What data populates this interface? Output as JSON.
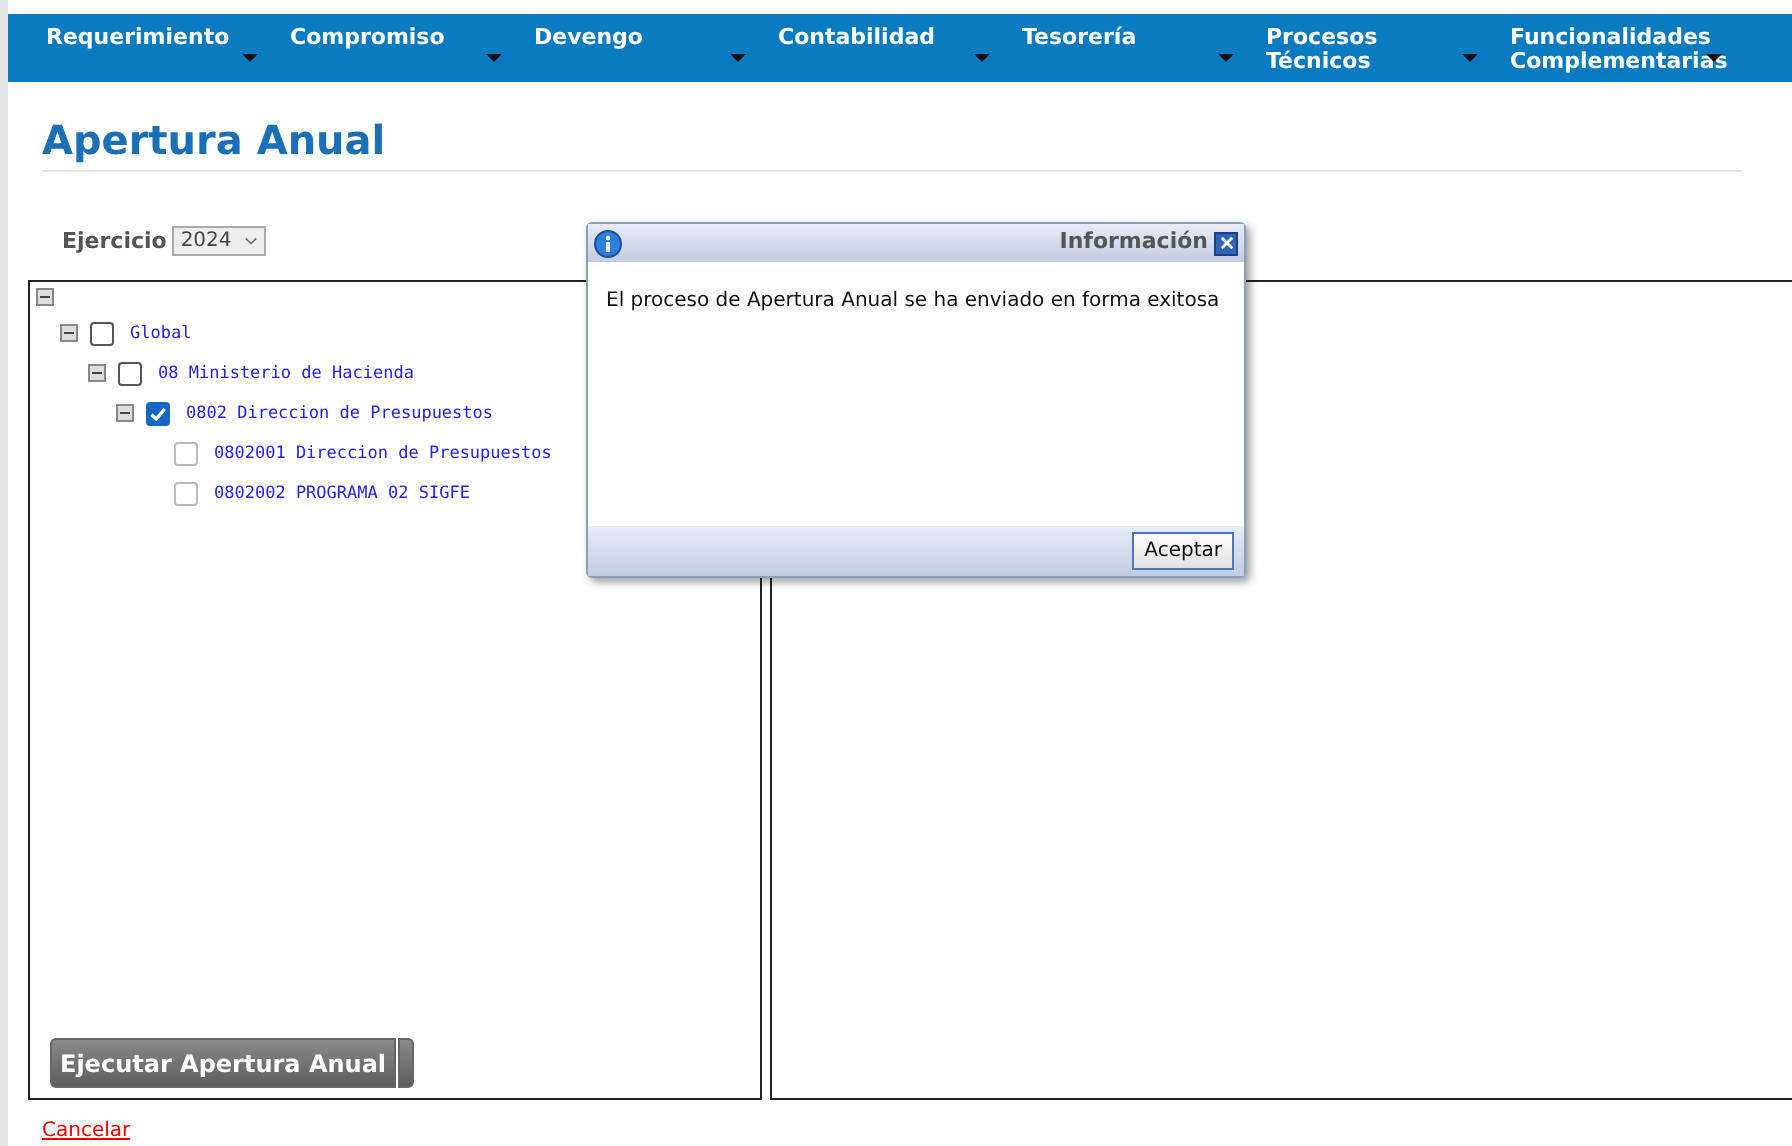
{
  "menu": [
    {
      "label": "Requerimiento"
    },
    {
      "label": "Compromiso"
    },
    {
      "label": "Devengo"
    },
    {
      "label": "Contabilidad"
    },
    {
      "label": "Tesorería"
    },
    {
      "label": "Procesos Técnicos"
    },
    {
      "label": "Funcionalidades Complementarias"
    }
  ],
  "page_title": "Apertura Anual",
  "ejercicio": {
    "label": "Ejercicio",
    "value": "2024"
  },
  "tree": {
    "expanded": true,
    "children": [
      {
        "label": "Global",
        "checked": false,
        "expanded": true,
        "children": [
          {
            "label": "08 Ministerio de Hacienda",
            "checked": false,
            "expanded": true,
            "children": [
              {
                "label": "0802 Direccion de Presupuestos",
                "checked": true,
                "expanded": true,
                "children": [
                  {
                    "label": "0802001 Direccion de Presupuestos",
                    "checked": false
                  },
                  {
                    "label": "0802002 PROGRAMA 02 SIGFE",
                    "checked": false
                  }
                ]
              }
            ]
          }
        ]
      }
    ]
  },
  "execute_button": "Ejecutar Apertura Anual",
  "cancel_link": "Cancelar",
  "dialog": {
    "title": "Información",
    "message": "El proceso de Apertura Anual se ha enviado en forma exitosa",
    "button": "Aceptar"
  }
}
